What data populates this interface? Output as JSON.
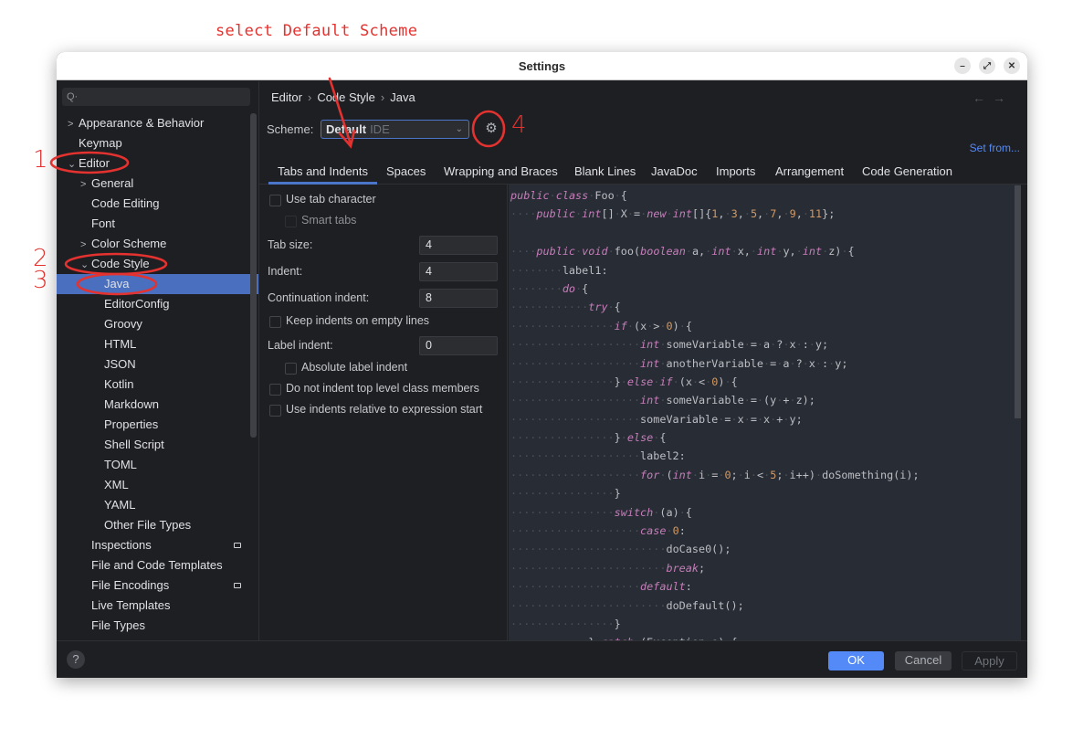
{
  "annotations": {
    "instruction": "select Default Scheme",
    "steps": [
      "1",
      "2",
      "3",
      "4"
    ]
  },
  "window": {
    "title": "Settings",
    "controls": {
      "minimize": "–",
      "maximize": "⤢",
      "close": "✕"
    }
  },
  "sidebar": {
    "search_placeholder": "Q·",
    "items": [
      {
        "label": "Appearance & Behavior",
        "chevron": ">"
      },
      {
        "label": "Keymap",
        "chevron": ""
      },
      {
        "label": "Editor",
        "chevron": "⌄"
      },
      {
        "label": "General",
        "chevron": ">"
      },
      {
        "label": "Code Editing",
        "chevron": ""
      },
      {
        "label": "Font",
        "chevron": ""
      },
      {
        "label": "Color Scheme",
        "chevron": ">"
      },
      {
        "label": "Code Style",
        "chevron": "⌄"
      },
      {
        "label": "Java",
        "chevron": "",
        "selected": true
      },
      {
        "label": "EditorConfig",
        "chevron": ""
      },
      {
        "label": "Groovy",
        "chevron": ""
      },
      {
        "label": "HTML",
        "chevron": ""
      },
      {
        "label": "JSON",
        "chevron": ""
      },
      {
        "label": "Kotlin",
        "chevron": ""
      },
      {
        "label": "Markdown",
        "chevron": ""
      },
      {
        "label": "Properties",
        "chevron": ""
      },
      {
        "label": "Shell Script",
        "chevron": ""
      },
      {
        "label": "TOML",
        "chevron": ""
      },
      {
        "label": "XML",
        "chevron": ""
      },
      {
        "label": "YAML",
        "chevron": ""
      },
      {
        "label": "Other File Types",
        "chevron": ""
      },
      {
        "label": "Inspections",
        "chevron": "",
        "badge": true
      },
      {
        "label": "File and Code Templates",
        "chevron": ""
      },
      {
        "label": "File Encodings",
        "chevron": "",
        "badge": true
      },
      {
        "label": "Live Templates",
        "chevron": ""
      },
      {
        "label": "File Types",
        "chevron": ""
      }
    ]
  },
  "main": {
    "breadcrumb": [
      "Editor",
      "Code Style",
      "Java"
    ],
    "breadcrumb_sep": "›",
    "nav_back": "←",
    "nav_forward": "→",
    "scheme": {
      "label": "Scheme:",
      "selected_name": "Default",
      "selected_kind": "IDE",
      "chevron": "⌄"
    },
    "set_from": "Set from...",
    "tabs": [
      "Tabs and Indents",
      "Spaces",
      "Wrapping and Braces",
      "Blank Lines",
      "JavaDoc",
      "Imports",
      "Arrangement",
      "Code Generation"
    ],
    "active_tab": "Tabs and Indents",
    "options": {
      "use_tab_character": {
        "label": "Use tab character",
        "checked": false
      },
      "smart_tabs": {
        "label": "Smart tabs",
        "checked": false,
        "disabled": true
      },
      "tab_size": {
        "label": "Tab size:",
        "value": "4"
      },
      "indent": {
        "label": "Indent:",
        "value": "4"
      },
      "continuation_indent": {
        "label": "Continuation indent:",
        "value": "8"
      },
      "keep_indents_empty": {
        "label": "Keep indents on empty lines",
        "checked": false
      },
      "label_indent": {
        "label": "Label indent:",
        "value": "0"
      },
      "absolute_label_indent": {
        "label": "Absolute label indent",
        "checked": false
      },
      "no_indent_top_level": {
        "label": "Do not indent top level class members",
        "checked": false
      },
      "indent_relative_expr": {
        "label": "Use indents relative to expression start",
        "checked": false
      }
    },
    "code_preview": [
      "public class Foo {",
      "    public int[] X = new int[]{1, 3, 5, 7, 9, 11};",
      "",
      "    public void foo(boolean a, int x, int y, int z) {",
      "        label1:",
      "        do {",
      "            try {",
      "                if (x > 0) {",
      "                    int someVariable = a ? x : y;",
      "                    int anotherVariable = a ? x : y;",
      "                } else if (x < 0) {",
      "                    int someVariable = (y + z);",
      "                    someVariable = x = x + y;",
      "                } else {",
      "                    label2:",
      "                    for (int i = 0; i < 5; i++) doSomething(i);",
      "                }",
      "                switch (a) {",
      "                    case 0:",
      "                        doCase0();",
      "                        break;",
      "                    default:",
      "                        doDefault();",
      "                }",
      "            } catch (Exception e) {"
    ]
  },
  "footer": {
    "help": "?",
    "ok": "OK",
    "cancel": "Cancel",
    "apply": "Apply"
  },
  "colors": {
    "accent": "#548af7",
    "selection": "#4a6fbf",
    "annotation": "#e3322f",
    "keyword": "#c77dbb",
    "number": "#d19a66"
  }
}
